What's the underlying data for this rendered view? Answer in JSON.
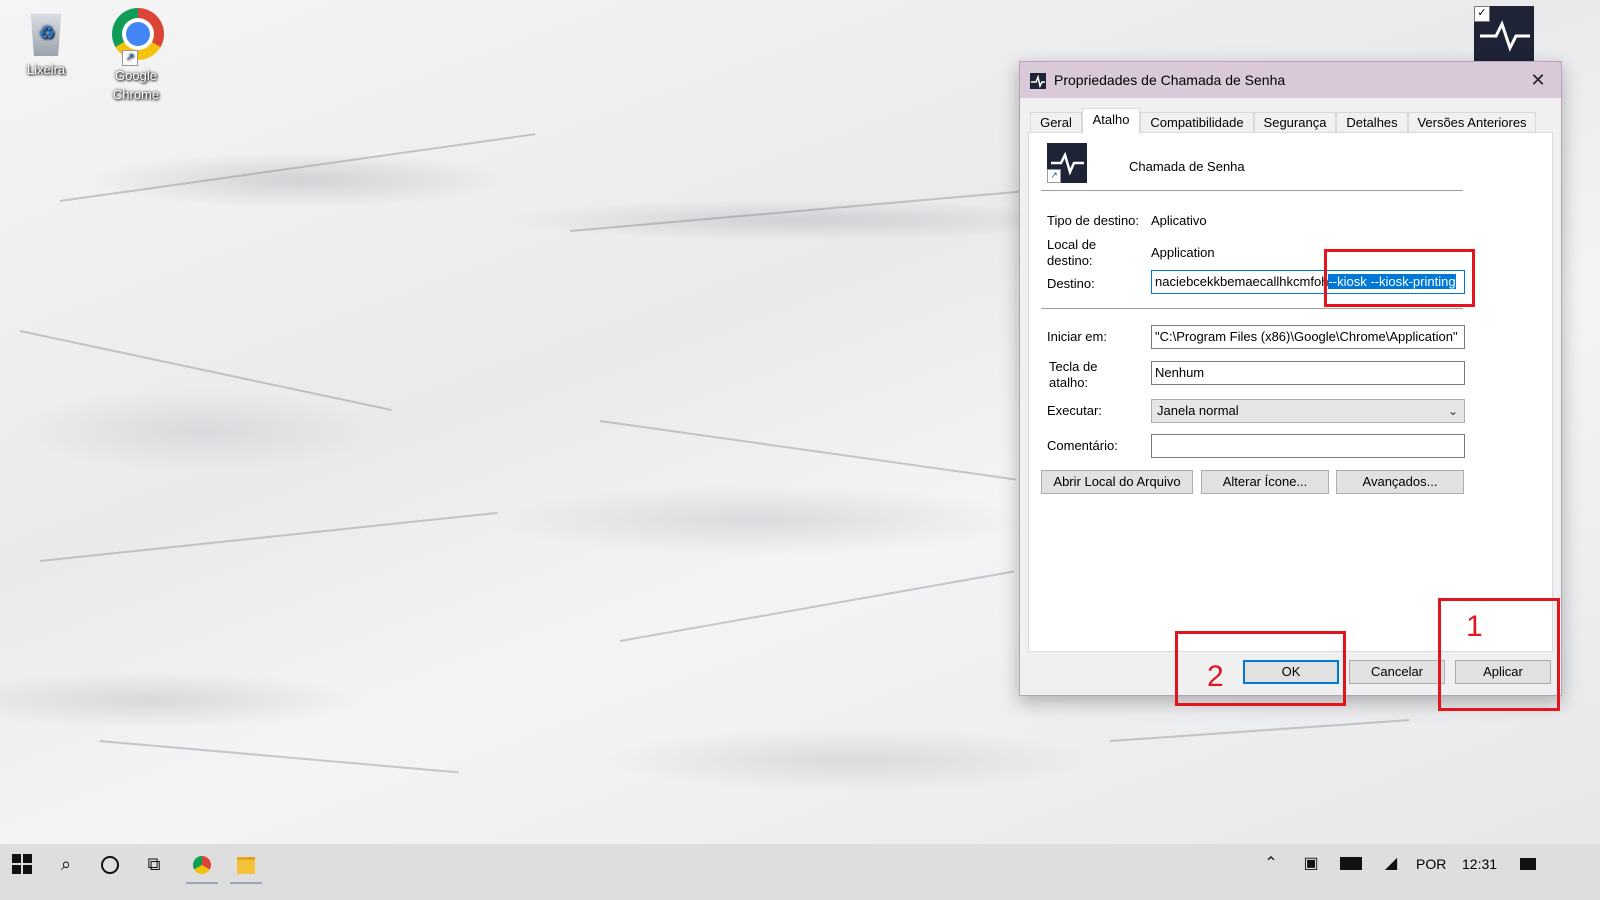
{
  "desktop": {
    "icons": [
      {
        "label": "Lixeira"
      },
      {
        "label": "Google Chrome"
      }
    ]
  },
  "dialog": {
    "title": "Propriedades de Chamada de Senha",
    "close_glyph": "✕",
    "tabs": [
      "Geral",
      "Atalho",
      "Compatibilidade",
      "Segurança",
      "Detalhes",
      "Versões Anteriores"
    ],
    "active_tab": "Atalho",
    "shortcut_name": "Chamada de Senha",
    "fields": {
      "tipo_destino_label": "Tipo de destino:",
      "tipo_destino_value": "Aplicativo",
      "local_destino_label_1": "Local de",
      "local_destino_label_2": "destino:",
      "local_destino_value": "Application",
      "destino_label": "Destino:",
      "destino_value_plain": "naciebcekkbemaecallhkcmfoh",
      "destino_value_selected": "--kiosk --kiosk-printing",
      "iniciar_label": "Iniciar em:",
      "iniciar_value": "\"C:\\Program Files (x86)\\Google\\Chrome\\Application\"",
      "tecla_label_1": "Tecla de",
      "tecla_label_2": "atalho:",
      "tecla_value": "Nenhum",
      "executar_label": "Executar:",
      "executar_value": "Janela normal",
      "comentario_label": "Comentário:",
      "comentario_value": ""
    },
    "action_buttons": {
      "abrir_local": "Abrir Local do Arquivo",
      "alterar_icone": "Alterar Ícone...",
      "avancados": "Avançados..."
    },
    "footer_buttons": {
      "ok": "OK",
      "cancelar": "Cancelar",
      "aplicar": "Aplicar"
    }
  },
  "annotations": {
    "step_1": "1",
    "step_2": "2",
    "color": "#e3141e"
  },
  "taskbar": {
    "language": "POR",
    "time": "12:31",
    "icons": [
      "windows-start-icon",
      "search-icon",
      "cortana-icon",
      "task-view-icon",
      "chrome-icon",
      "file-explorer-icon",
      "chevron-up-icon",
      "meet-now-icon",
      "battery-icon",
      "wifi-icon",
      "notifications-icon"
    ]
  }
}
